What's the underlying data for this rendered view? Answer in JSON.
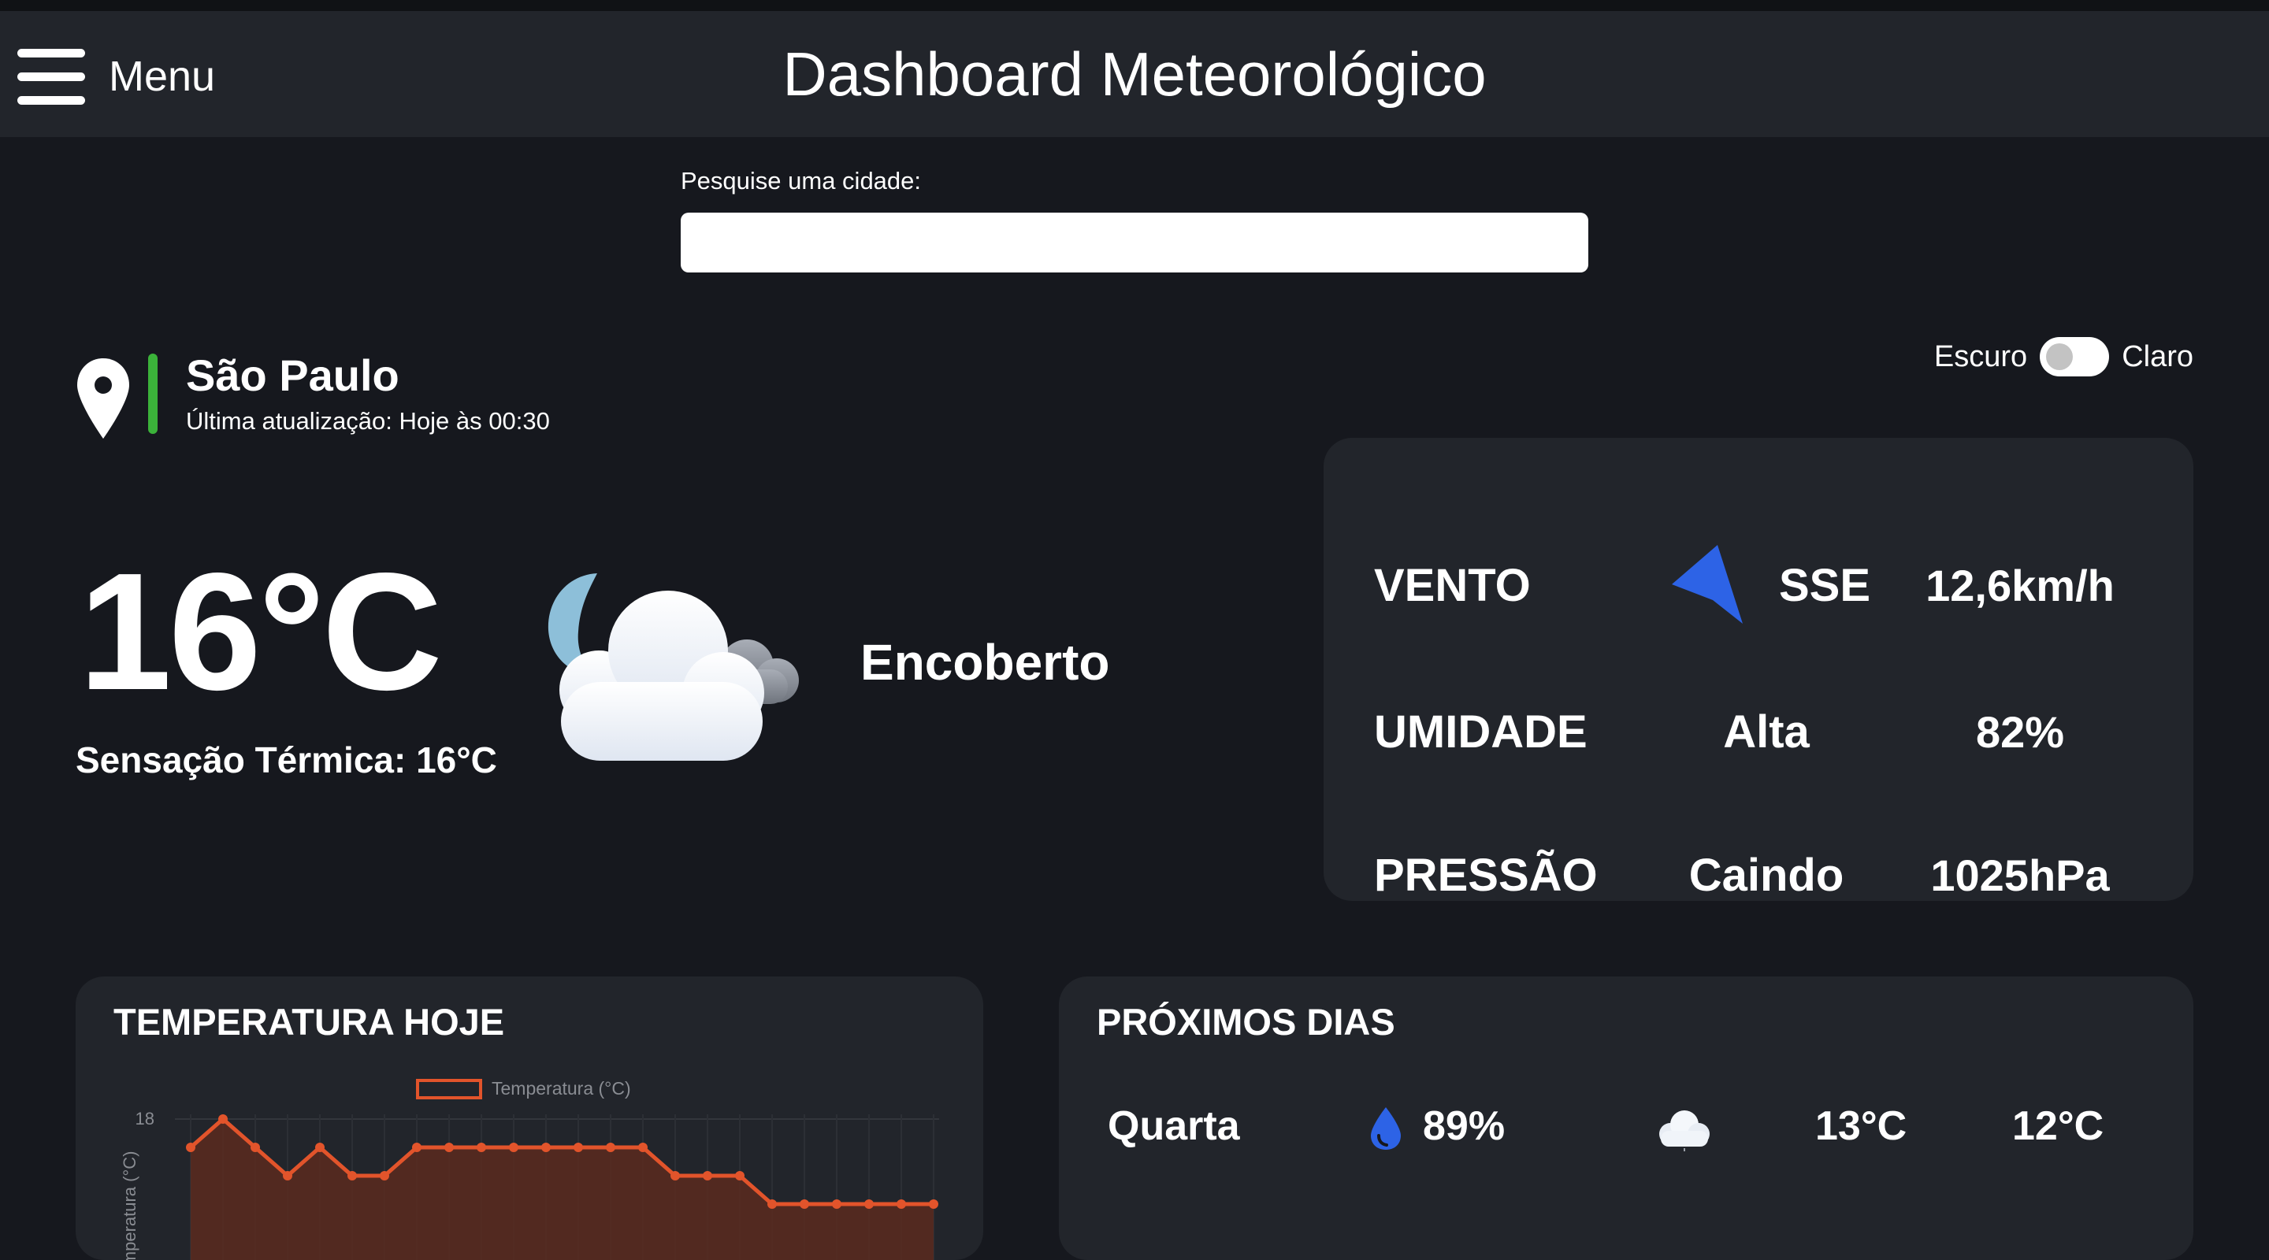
{
  "header": {
    "menu_label": "Menu",
    "title": "Dashboard Meteorológico"
  },
  "search": {
    "label": "Pesquise uma cidade:",
    "value": "",
    "placeholder": ""
  },
  "theme": {
    "dark_label": "Escuro",
    "light_label": "Claro",
    "is_light": false
  },
  "location": {
    "city": "São Paulo",
    "updated": "Última atualização: Hoje às 00:30"
  },
  "current": {
    "temperature": "16°C",
    "feels_like": "Sensação Térmica: 16°C",
    "condition": "Encoberto",
    "icon": "moon-cloud-icon"
  },
  "stats": {
    "wind": {
      "label": "VENTO",
      "direction": "SSE",
      "value": "12,6km/h",
      "icon": "wind-arrow-icon"
    },
    "humidity": {
      "label": "UMIDADE",
      "level": "Alta",
      "value": "82%"
    },
    "pressure": {
      "label": "PRESSÃO",
      "trend": "Caindo",
      "value": "1025hPa"
    }
  },
  "today_temperature": {
    "title": "TEMPERATURA HOJE"
  },
  "chart_data": {
    "type": "line",
    "title": "",
    "legend": [
      "Temperatura (°C)"
    ],
    "legend_position": "top",
    "ylabel": "Temperatura (°C)",
    "xlabel": "",
    "y_ticks": [
      18
    ],
    "series": [
      {
        "name": "Temperatura (°C)",
        "values": [
          17.6,
          18.0,
          17.6,
          17.2,
          17.6,
          17.2,
          17.2,
          17.6,
          17.6,
          17.6,
          17.6,
          17.6,
          17.6,
          17.6,
          17.6,
          17.2,
          17.2,
          17.2,
          16.8,
          16.8,
          16.8,
          16.8,
          16.8,
          16.8
        ]
      }
    ],
    "color": "#e2542b",
    "grid": true
  },
  "next_days": {
    "title": "PRÓXIMOS DIAS",
    "days": [
      {
        "name": "Quarta",
        "rain": "89%",
        "icon": "cloud-icon",
        "max": "13°C",
        "min": "12°C"
      }
    ]
  },
  "colors": {
    "background": "#16181e",
    "panel": "#22252b",
    "accent_green": "#3bb23a",
    "wind_arrow": "#2d63e6",
    "chart_line": "#e2542b"
  }
}
